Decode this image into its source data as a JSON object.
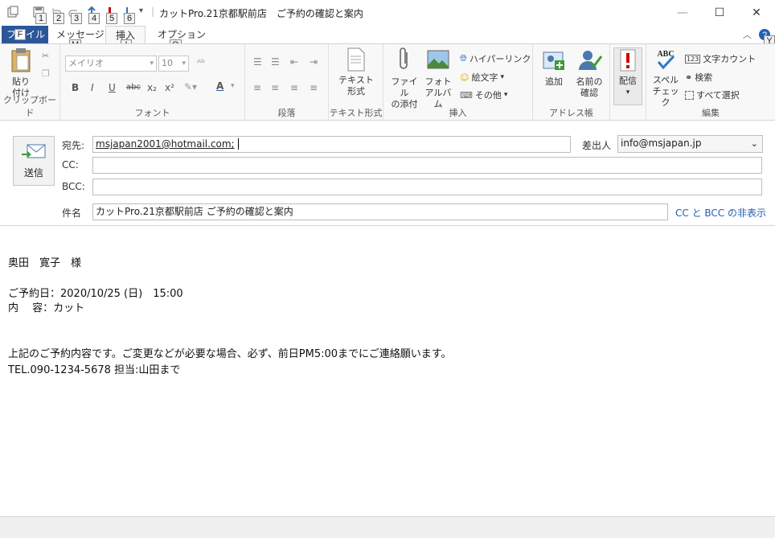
{
  "window": {
    "title": "カットPro.21京都駅前店　ご予約の確認と案内",
    "qat_keytips": [
      "1",
      "2",
      "3",
      "4",
      "5",
      "6"
    ],
    "controls": {
      "minimize": "—",
      "maximize": "☐",
      "close": "✕"
    }
  },
  "tabs": {
    "file": "ファイル",
    "file_keytip": "F",
    "message": "メッセージ",
    "message_keytip": "M",
    "insert": "挿入",
    "insert_keytip": "I",
    "options": "オプション",
    "options_keytip": "O",
    "help_keytip": "Y"
  },
  "ribbon": {
    "clipboard": {
      "label": "クリップボード",
      "paste": "貼り\n付け"
    },
    "font": {
      "label": "フォント",
      "family": "メイリオ",
      "size": "10"
    },
    "paragraph": {
      "label": "段落"
    },
    "text_format": {
      "label": "テキスト形式",
      "plain": "テキスト\n形式"
    },
    "insert": {
      "label": "挿入",
      "attach": "ファイル\nの添付",
      "photo": "フォト\nアルバム",
      "hyperlink": "ハイパーリンク",
      "emoji": "絵文字",
      "other": "その他"
    },
    "address": {
      "label": "アドレス帳",
      "add": "追加",
      "check_names": "名前の\n確認"
    },
    "delivery": {
      "label": "配信"
    },
    "edit": {
      "label": "編集",
      "spell": "スペル\nチェック",
      "word_count": "文字カウント",
      "find": "検索",
      "select_all": "すべて選択"
    }
  },
  "compose": {
    "send": "送信",
    "to_label": "宛先:",
    "to_value": "msjapan2001@hotmail.com;",
    "cc_label": "CC:",
    "cc_value": "",
    "bcc_label": "BCC:",
    "bcc_value": "",
    "subject_label": "件名",
    "subject_value": "カットPro.21京都駅前店  ご予約の確認と案内",
    "from_label": "差出人",
    "from_value": "info@msjapan.jp",
    "hide_cc_bcc": "CC と BCC の非表示"
  },
  "body": {
    "lines": [
      "奥田　寛子　様",
      "ご予約日：2020/10/25 (日)　15:00",
      "内　 容：カット",
      "上記のご予約内容です。ご変更などが必要な場合、必ず、前日PM5:00までにご連絡願います。",
      "TEL.090-1234-5678 担当:山田まで"
    ]
  }
}
